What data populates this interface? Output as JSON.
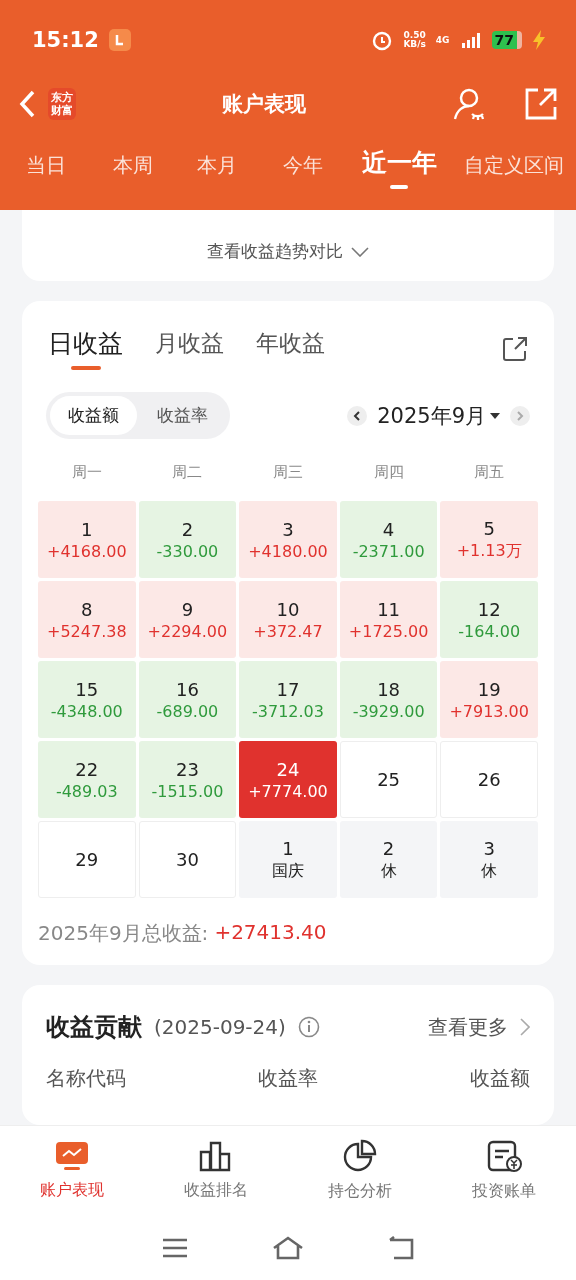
{
  "status_bar": {
    "time": "15:12",
    "speed": "0.50",
    "speed_unit": "KB/s",
    "network": "4G",
    "battery": "77"
  },
  "header": {
    "title": "账户表现",
    "logo": [
      "东方",
      "财富"
    ]
  },
  "period_tabs": [
    {
      "label": "当日",
      "selected": false
    },
    {
      "label": "本周",
      "selected": false
    },
    {
      "label": "本月",
      "selected": false
    },
    {
      "label": "今年",
      "selected": false
    },
    {
      "label": "近一年",
      "selected": true
    },
    {
      "label": "自定义区间",
      "selected": false
    }
  ],
  "trend_link": "查看收益趋势对比",
  "calendar_card": {
    "tabs": [
      {
        "label": "日收益",
        "selected": true
      },
      {
        "label": "月收益",
        "selected": false
      },
      {
        "label": "年收益",
        "selected": false
      }
    ],
    "toggle": [
      {
        "label": "收益额",
        "selected": true
      },
      {
        "label": "收益率",
        "selected": false
      }
    ],
    "month": "2025年9月",
    "weekdays": [
      "周一",
      "周二",
      "周三",
      "周四",
      "周五"
    ],
    "days": [
      {
        "day": "1",
        "value": "+4168.00",
        "kind": "gain"
      },
      {
        "day": "2",
        "value": "-330.00",
        "kind": "loss"
      },
      {
        "day": "3",
        "value": "+4180.00",
        "kind": "gain"
      },
      {
        "day": "4",
        "value": "-2371.00",
        "kind": "loss"
      },
      {
        "day": "5",
        "value": "+1.13万",
        "kind": "gain"
      },
      {
        "day": "8",
        "value": "+5247.38",
        "kind": "gain"
      },
      {
        "day": "9",
        "value": "+2294.00",
        "kind": "gain"
      },
      {
        "day": "10",
        "value": "+372.47",
        "kind": "gain"
      },
      {
        "day": "11",
        "value": "+1725.00",
        "kind": "gain"
      },
      {
        "day": "12",
        "value": "-164.00",
        "kind": "loss"
      },
      {
        "day": "15",
        "value": "-4348.00",
        "kind": "loss"
      },
      {
        "day": "16",
        "value": "-689.00",
        "kind": "loss"
      },
      {
        "day": "17",
        "value": "-3712.03",
        "kind": "loss"
      },
      {
        "day": "18",
        "value": "-3929.00",
        "kind": "loss"
      },
      {
        "day": "19",
        "value": "+7913.00",
        "kind": "gain"
      },
      {
        "day": "22",
        "value": "-489.03",
        "kind": "loss"
      },
      {
        "day": "23",
        "value": "-1515.00",
        "kind": "loss"
      },
      {
        "day": "24",
        "value": "+7774.00",
        "kind": "today"
      },
      {
        "day": "25",
        "kind": "empty"
      },
      {
        "day": "26",
        "kind": "empty"
      },
      {
        "day": "29",
        "kind": "empty"
      },
      {
        "day": "30",
        "kind": "empty"
      },
      {
        "day": "1",
        "value": "国庆",
        "kind": "holiday"
      },
      {
        "day": "2",
        "value": "休",
        "kind": "holiday"
      },
      {
        "day": "3",
        "value": "休",
        "kind": "holiday"
      }
    ],
    "total_label": "2025年9月总收益:",
    "total_value": "+27413.40"
  },
  "contribution": {
    "title": "收益贡献",
    "date": "(2025-09-24)",
    "more": "查看更多",
    "columns": [
      "名称代码",
      "收益率",
      "收益额"
    ]
  },
  "bottom_nav": [
    {
      "label": "账户表现",
      "selected": true,
      "kind": "monitor"
    },
    {
      "label": "收益排名",
      "selected": false,
      "kind": "bars"
    },
    {
      "label": "持仓分析",
      "selected": false,
      "kind": "pie"
    },
    {
      "label": "投资账单",
      "selected": false,
      "kind": "bill"
    }
  ]
}
